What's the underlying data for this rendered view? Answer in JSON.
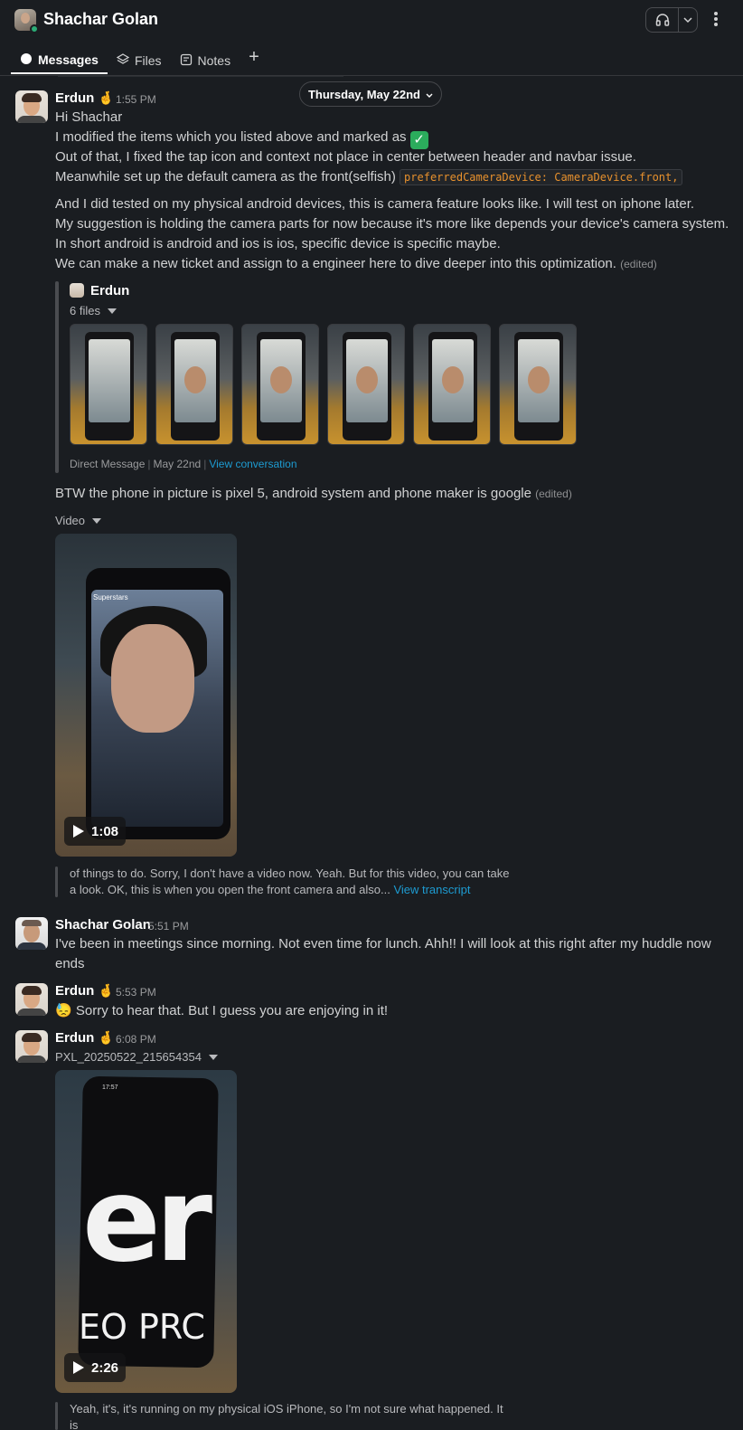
{
  "header": {
    "title": "Shachar Golan",
    "tabs": [
      {
        "label": "Messages"
      },
      {
        "label": "Files"
      },
      {
        "label": "Notes"
      }
    ],
    "add_tab": "+"
  },
  "date_divider": "Thursday, May 22nd",
  "messages": [
    {
      "author": "Erdun",
      "author_emoji": "🤞",
      "time": "1:55 PM",
      "lines": [
        "Hi Shachar",
        "I modified the items which you listed above and marked as",
        "Out of that, I fixed the tap icon and context not place in center between header and navbar issue.",
        "Meanwhile set up the default camera as the front(selfish)",
        "And I did tested on my physical android devices, this is camera feature looks like. I will test on iphone later.",
        "My suggestion is holding the camera parts for now because it's more like depends your device's camera system.",
        "In short android is android and ios is ios, specific device is specific maybe.",
        "We can make a new ticket and assign to a engineer here to dive deeper into this optimization."
      ],
      "code": "preferredCameraDevice: CameraDevice.front,",
      "edited": "(edited)",
      "shared": {
        "author": "Erdun",
        "files_label": "6 files",
        "meta_source": "Direct Message",
        "meta_date": "May 22nd",
        "meta_link": "View conversation"
      },
      "followup": "BTW the phone in picture is pixel 5, android system and phone maker is  google",
      "followup_edited": "(edited)",
      "video_label": "Video",
      "video_duration": "1:08",
      "video_overlay": "Superstars",
      "transcript_1": "of things to do. Sorry, I don't have a video now. Yeah. But for this video, you can take",
      "transcript_2": "a look. OK, this is when you open the front camera and also...",
      "transcript_link": "View transcript"
    },
    {
      "author": "Shachar Golan",
      "time": "5:51 PM",
      "line1": "I've been in meetings since morning. Not even time for lunch. Ahh!! I will look at this right after my huddle now",
      "line2": "ends"
    },
    {
      "author": "Erdun",
      "author_emoji": "🤞",
      "time": "5:53 PM",
      "emoji": "😓",
      "text": "Sorry to hear that. But I guess you are enjoying in it!"
    },
    {
      "author": "Erdun",
      "author_emoji": "🤞",
      "time": "6:08 PM",
      "file_name": "PXL_20250522_215654354",
      "video_duration": "2:26",
      "video_text_1": "er",
      "video_text_2": "EO PRC",
      "video_clock": "17:57",
      "transcript": "Yeah, it's, it's running on my physical iOS iPhone, so I'm not sure what happened. It is"
    }
  ],
  "colors": {
    "background": "#1a1d21",
    "link": "#1d9bd1",
    "code": "#e8912d",
    "presence": "#2bac76",
    "check": "#2bac5c"
  }
}
